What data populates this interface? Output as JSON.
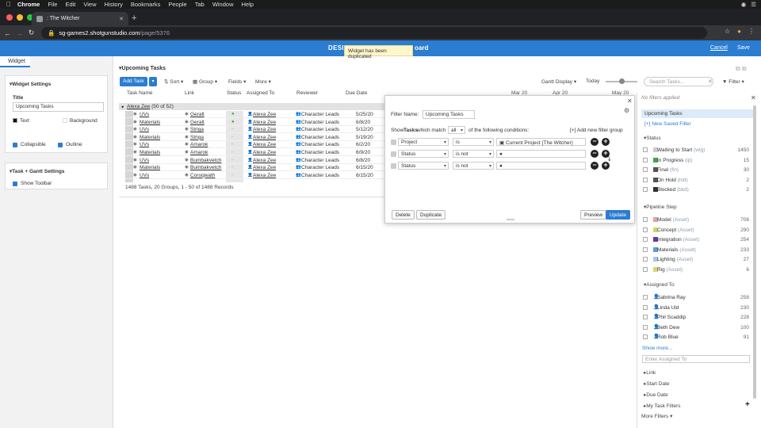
{
  "os_menu": {
    "app": "Chrome",
    "items": [
      "File",
      "Edit",
      "View",
      "History",
      "Bookmarks",
      "People",
      "Tab",
      "Window",
      "Help"
    ]
  },
  "browser": {
    "tab_title": ": The Witcher",
    "url_host": "sg-games2.shotgunstudio.com",
    "url_path": "/page/5376"
  },
  "app_header": {
    "title_left": "DESI",
    "title_right": "oard",
    "cancel_label": "Cancel",
    "save_label": "Save",
    "toast": "Widget has been duplicated"
  },
  "left_panel": {
    "tab": "Widget",
    "widget_settings": {
      "heading": "Widget Settings",
      "title_label": "Title",
      "title_value": "Upcoming Tasks",
      "text_label": "Text",
      "background_label": "Background",
      "collapsible_label": "Collapsible",
      "outline_label": "Outline"
    },
    "gantt_settings": {
      "heading": "Task + Gantt Settings",
      "show_toolbar_label": "Show Toolbar"
    }
  },
  "main": {
    "section_title": "Upcoming Tasks",
    "toolbar": {
      "add_task": "Add Task",
      "sort": "Sort",
      "group": "Group",
      "fields": "Fields",
      "more": "More",
      "gantt_display": "Gantt Display",
      "today": "Today",
      "search_placeholder": "Search Tasks...",
      "filter": "Filter"
    },
    "columns": [
      "Task Name",
      "Link",
      "Status",
      "Assigned To",
      "Reviewer",
      "Due Date"
    ],
    "gantt_months": [
      "Mar 20",
      "Apr 20",
      "May 20"
    ],
    "group_label": "Alexa Zee",
    "group_count": "(50 of 52)",
    "rows": [
      {
        "task": "UVs",
        "link": "Geralt",
        "assigned": "Alexa Zee",
        "reviewer": "Character Leads",
        "due": "5/25/20"
      },
      {
        "task": "Materials",
        "link": "Geralt",
        "assigned": "Alexa Zee",
        "reviewer": "Character Leads",
        "due": "6/8/20"
      },
      {
        "task": "UVs",
        "link": "Striga",
        "assigned": "Alexa Zee",
        "reviewer": "Character Leads",
        "due": "5/12/20"
      },
      {
        "task": "Materials",
        "link": "Striga",
        "assigned": "Alexa Zee",
        "reviewer": "Character Leads",
        "due": "5/19/20"
      },
      {
        "task": "UVs",
        "link": "Amarok",
        "assigned": "Alexa Zee",
        "reviewer": "Character Leads",
        "due": "6/2/20"
      },
      {
        "task": "Materials",
        "link": "Amarok",
        "assigned": "Alexa Zee",
        "reviewer": "Character Leads",
        "due": "6/9/20"
      },
      {
        "task": "UVs",
        "link": "Bumbakvetch",
        "assigned": "Alexa Zee",
        "reviewer": "Character Leads",
        "due": "6/8/20"
      },
      {
        "task": "Materials",
        "link": "Bumbakvetch",
        "assigned": "Alexa Zee",
        "reviewer": "Character Leads",
        "due": "6/15/20"
      },
      {
        "task": "UVs",
        "link": "Coroqwath",
        "assigned": "Alexa Zee",
        "reviewer": "Character Leads",
        "due": "6/15/20"
      }
    ],
    "footer": "1488 Tasks, 20 Groups, 1 - 50 of 1488 Records"
  },
  "filter_dialog": {
    "filter_name_label": "Filter Name:",
    "filter_name_value": "Upcoming Tasks",
    "match_prefix": "Show",
    "match_entity": "Tasks",
    "match_mid": "which match",
    "match_value": "all",
    "match_suffix": "of the following conditions:",
    "add_group": "[+] Add new filter group",
    "conditions": [
      {
        "field": "Project",
        "op": "is",
        "value": "Current Project (The Witcher)"
      },
      {
        "field": "Status",
        "op": "is not",
        "value": ""
      },
      {
        "field": "Status",
        "op": "is not",
        "value": ""
      }
    ],
    "delete": "Delete",
    "duplicate": "Duplicate",
    "preview": "Preview",
    "update": "Update"
  },
  "right_panel": {
    "no_filters": "No filters applied",
    "selected_filter": "Upcoming Tasks",
    "new_saved_filter": "[+] New Saved Filter",
    "status_heading": "Status",
    "status_items": [
      {
        "label": "Waiting to Start",
        "code": "(wtg)",
        "count": "1450",
        "color": "#cccccc"
      },
      {
        "label": "In Progress",
        "code": "(ip)",
        "count": "15",
        "color": "#3aa84a"
      },
      {
        "label": "Final",
        "code": "(fin)",
        "count": "30",
        "color": "#555555"
      },
      {
        "label": "On Hold",
        "code": "(hld)",
        "count": "2",
        "color": "#555555"
      },
      {
        "label": "Blocked",
        "code": "(bkd)",
        "count": "2",
        "color": "#333333"
      }
    ],
    "pipeline_heading": "Pipeline Step",
    "pipeline_items": [
      {
        "label": "Model",
        "code": "(Asset)",
        "count": "708",
        "color": "#e8a0a0"
      },
      {
        "label": "Concept",
        "code": "(Asset)",
        "count": "290",
        "color": "#c8d96a"
      },
      {
        "label": "Integration",
        "code": "(Asset)",
        "count": "254",
        "color": "#6a3aa0"
      },
      {
        "label": "Materials",
        "code": "(Asset)",
        "count": "233",
        "color": "#5aa0d8"
      },
      {
        "label": "Lighting",
        "code": "(Asset)",
        "count": "27",
        "color": "#a8c8e8"
      },
      {
        "label": "Rig",
        "code": "(Asset)",
        "count": "6",
        "color": "#d8d870"
      }
    ],
    "assigned_heading": "Assigned To",
    "assigned_items": [
      {
        "label": "Sabrina Ray",
        "count": "258"
      },
      {
        "label": "Linda Uld",
        "count": "230"
      },
      {
        "label": "Phil Scaddip",
        "count": "228"
      },
      {
        "label": "Beth Dew",
        "count": "100"
      },
      {
        "label": "Rob Blue",
        "count": "91"
      }
    ],
    "show_more": "Show more...",
    "enter_assigned_placeholder": "Enter Assigned To",
    "collapsed_sections": [
      "Link",
      "Start Date",
      "Due Date",
      "My Task Filters"
    ],
    "more_filters": "More Filters"
  },
  "colors": {
    "accent": "#2b7dd1",
    "header": "#2b7dd1",
    "toast_bg": "#fff6cc"
  }
}
